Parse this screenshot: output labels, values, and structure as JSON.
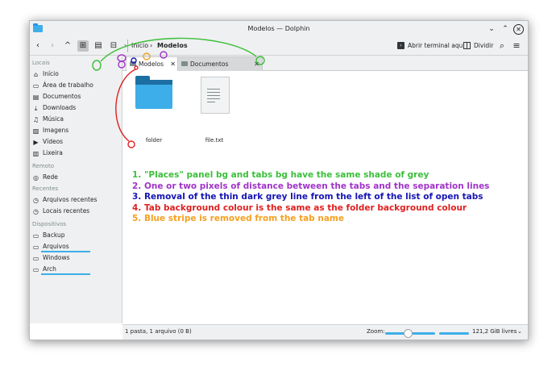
{
  "window": {
    "title": "Modelos — Dolphin"
  },
  "titlebar": {
    "minimize": "⌄",
    "maximize": "⌃",
    "close": "✕"
  },
  "toolbar": {
    "back": "‹",
    "forward": "›",
    "up": "^",
    "view_icons": "⊞",
    "view_compact": "▤",
    "view_details": "⊟",
    "breadcrumb_sep1": "›",
    "breadcrumb_home": "Início",
    "breadcrumb_sep2": "›",
    "breadcrumb_current": "Modelos",
    "terminal_label": "Abrir terminal aqui",
    "split_label": "Dividir",
    "search": "⌕",
    "menu": "≡"
  },
  "sidebar": {
    "sections": {
      "places": "Locais",
      "remote": "Remoto",
      "recent": "Recentes",
      "devices": "Dispositivos"
    },
    "places": [
      {
        "label": "Início",
        "icon": "home-icon",
        "glyph": "⌂"
      },
      {
        "label": "Área de trabalho",
        "icon": "desktop-icon",
        "glyph": "▭"
      },
      {
        "label": "Documentos",
        "icon": "documents-icon",
        "glyph": "▤"
      },
      {
        "label": "Downloads",
        "icon": "download-icon",
        "glyph": "⤓"
      },
      {
        "label": "Música",
        "icon": "music-icon",
        "glyph": "♫"
      },
      {
        "label": "Imagens",
        "icon": "images-icon",
        "glyph": "▨"
      },
      {
        "label": "Vídeos",
        "icon": "videos-icon",
        "glyph": "▶"
      },
      {
        "label": "Lixeira",
        "icon": "trash-icon",
        "glyph": "▥"
      }
    ],
    "remote": [
      {
        "label": "Rede",
        "icon": "network-icon",
        "glyph": "◎"
      }
    ],
    "recent": [
      {
        "label": "Arquivos recentes",
        "icon": "recent-files-icon",
        "glyph": "◷"
      },
      {
        "label": "Locais recentes",
        "icon": "recent-locations-icon",
        "glyph": "◷"
      }
    ],
    "devices": [
      {
        "label": "Backup",
        "icon": "drive-icon",
        "glyph": "▭"
      },
      {
        "label": "Arquivos",
        "icon": "drive-icon",
        "glyph": "▭",
        "usage": 0.64
      },
      {
        "label": "Windows",
        "icon": "drive-icon",
        "glyph": "▭"
      },
      {
        "label": "Arch",
        "icon": "drive-icon",
        "glyph": "▭",
        "usage": 0.64
      }
    ]
  },
  "tabs": [
    {
      "label": "Modelos",
      "close": "✕",
      "active": true
    },
    {
      "label": "Documentos",
      "close": "✕",
      "active": false
    }
  ],
  "files": [
    {
      "name": "folder",
      "type": "folder"
    },
    {
      "name": "file.txt",
      "type": "text-file"
    }
  ],
  "annotations": [
    {
      "text": "1. \"Places\" panel bg and tabs bg have the same shade of grey",
      "color": "#3bbf3b"
    },
    {
      "text": "2. One or two pixels of distance between the tabs and the separation lines",
      "color": "#a034c8"
    },
    {
      "text": "3. Removal of the thin dark grey line from the left of the list of open tabs",
      "color": "#1515b5"
    },
    {
      "text": "4. Tab background colour is the same as the folder background colour",
      "color": "#e02020"
    },
    {
      "text": "5. Blue stripe is removed from the tab name",
      "color": "#f5a020"
    }
  ],
  "statusbar": {
    "summary": "1 pasta, 1 arquivo (0 B)",
    "zoom_label": "Zoom:",
    "zoom_level": 0.38,
    "free_space": "121,2 GiB livres",
    "free_chevron": "⌄"
  },
  "colors": {
    "accent": "#3daee9",
    "panel_bg": "#eff0f1",
    "green": "#3bbf3b",
    "purple": "#a034c8",
    "red": "#e02020",
    "orange": "#f5a020"
  }
}
